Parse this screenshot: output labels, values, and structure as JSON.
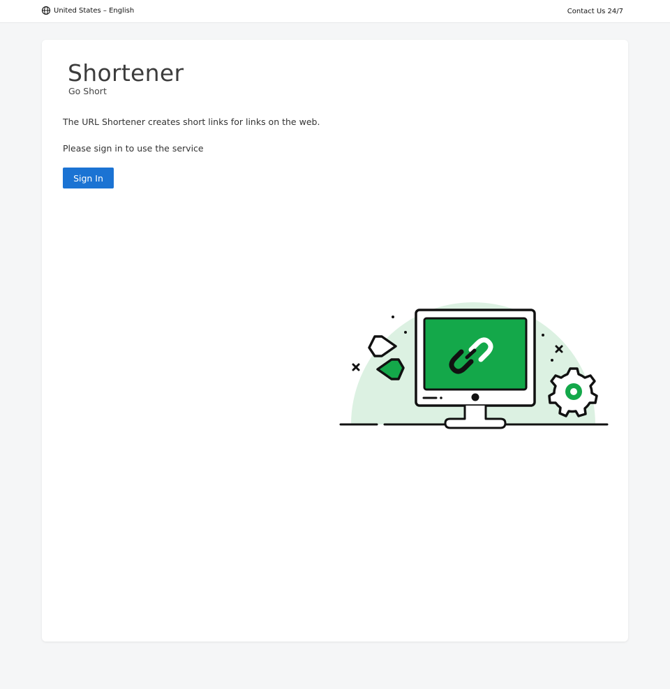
{
  "header": {
    "locale_label": "United States – English",
    "contact_label": "Contact Us 24/7"
  },
  "card": {
    "title": "Shortener",
    "subtitle": "Go Short",
    "description": "The URL Shortener creates short links for links on the web.",
    "signin_prompt": "Please sign in to use the service",
    "signin_button": "Sign In"
  },
  "colors": {
    "accent": "#1b73d3",
    "illustration_green": "#14a84a",
    "illustration_bg": "#dcf1e2"
  },
  "icons": {
    "locale": "globe-icon",
    "illustration": "link-computer-illustration"
  }
}
